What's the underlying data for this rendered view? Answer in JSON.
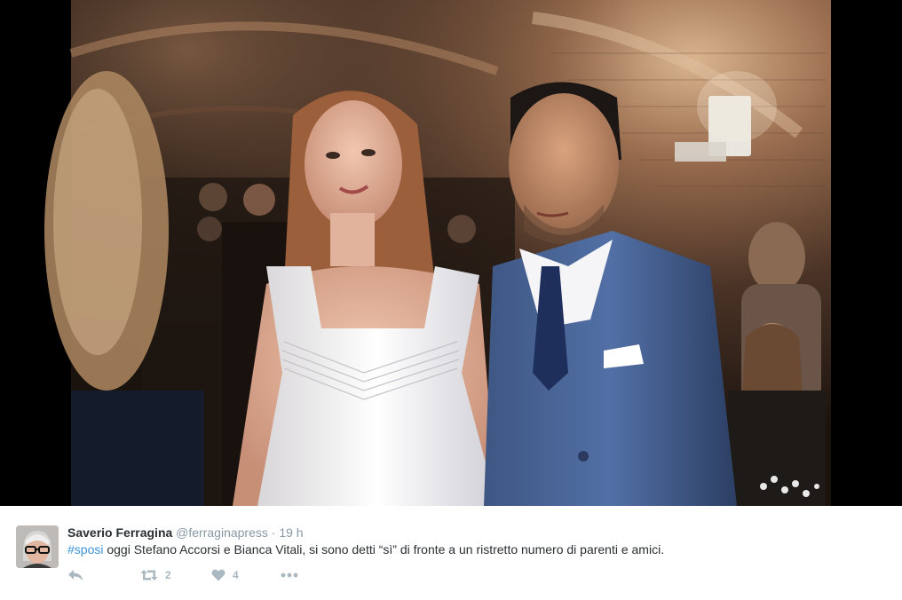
{
  "tweet": {
    "author": {
      "display_name": "Saverio Ferragina",
      "handle": "@ferraginapress",
      "avatar_icon": "profile-photo"
    },
    "separator": "·",
    "time": "19 h",
    "hashtag": "#sposi",
    "text": " oggi Stefano Accorsi e Bianca Vitali, si sono detti “sì” di fronte a un ristretto numero di parenti e amici.",
    "media": {
      "kind": "photo"
    },
    "actions": {
      "reply": {
        "icon": "reply-icon"
      },
      "retweet": {
        "icon": "retweet-icon",
        "count": "2"
      },
      "like": {
        "icon": "heart-icon",
        "count": "4"
      },
      "more": {
        "icon": "more-icon"
      }
    }
  },
  "colors": {
    "text": "#292f33",
    "muted": "#8899a6",
    "link": "#3b94d9",
    "action": "#aab8c2",
    "letterbox": "#000000"
  }
}
